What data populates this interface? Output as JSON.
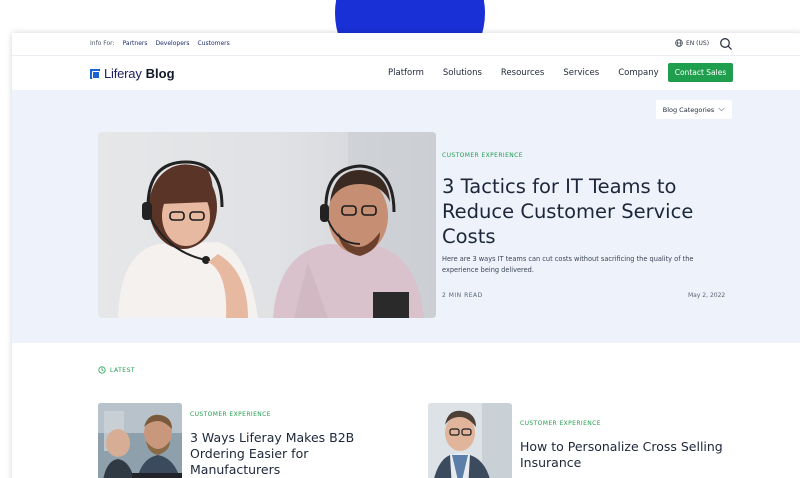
{
  "colors": {
    "accent_green": "#1f9e4e",
    "hero_background": "#edf2fb",
    "brand_blue": "#1a61d1",
    "backdrop_blob": "#1930d6"
  },
  "utility_bar": {
    "info_label": "Info For:",
    "links": [
      "Partners",
      "Developers",
      "Customers"
    ],
    "language": "EN (US)",
    "language_icon": "globe-icon",
    "search_icon": "search-icon"
  },
  "header": {
    "logo_word": "Liferay",
    "logo_blog": "Blog",
    "nav": [
      "Platform",
      "Solutions",
      "Resources",
      "Services",
      "Company"
    ],
    "cta_label": "Contact Sales"
  },
  "hero": {
    "categories_label": "Blog Categories",
    "category": "CUSTOMER EXPERIENCE",
    "title": "3 Tactics for IT Teams to Reduce Customer Service Costs",
    "excerpt": "Here are 3 ways IT teams can cut costs without sacrificing the quality of the experience being delivered.",
    "read_time": "2 MIN READ",
    "date": "May 2, 2022"
  },
  "latest": {
    "label": "LATEST",
    "icon": "clock-icon",
    "cards": [
      {
        "category": "CUSTOMER EXPERIENCE",
        "title": "3 Ways Liferay Makes B2B Ordering Easier for Manufacturers"
      },
      {
        "category": "CUSTOMER EXPERIENCE",
        "title": "How to Personalize Cross Selling Insurance"
      }
    ]
  }
}
